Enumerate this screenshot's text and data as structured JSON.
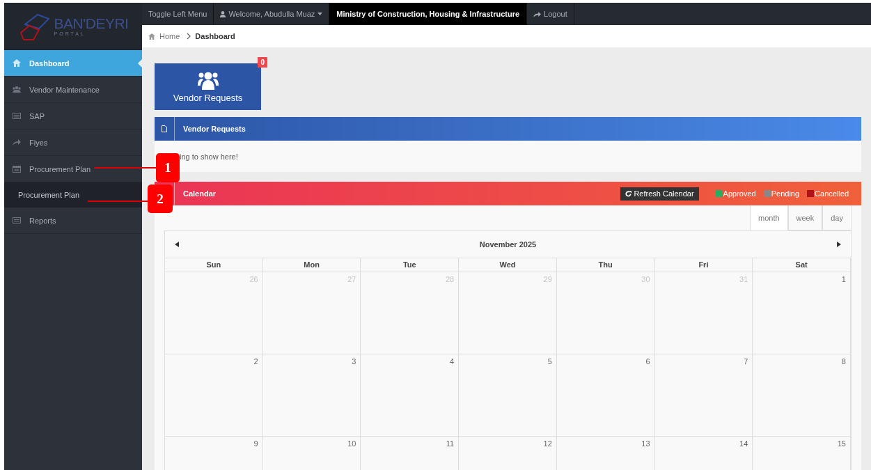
{
  "logo": {
    "name": "BAN'DEYRI",
    "tagline": "PORTAL"
  },
  "topbar": {
    "items": [
      {
        "label": "Toggle Left Menu",
        "kind": "plain"
      },
      {
        "label": "Welcome, Abudulla Muaz",
        "kind": "user"
      },
      {
        "label": "Ministry of Construction, Housing & Infrastructure",
        "kind": "title"
      },
      {
        "label": "Logout",
        "kind": "logout"
      }
    ]
  },
  "breadcrumb": [
    {
      "label": "Home",
      "selected": false
    },
    {
      "label": "Dashboard",
      "selected": true
    }
  ],
  "sidebar": {
    "items": [
      {
        "label": "Dashboard",
        "selected": true
      },
      {
        "label": "Vendor Maintenance",
        "selected": false
      },
      {
        "label": "SAP",
        "selected": false
      },
      {
        "label": "Fiyes",
        "selected": false
      },
      {
        "label": "Procurement Plan",
        "selected": false,
        "expanded": true,
        "children": [
          {
            "label": "Procurement Plan",
            "selected": false
          }
        ]
      },
      {
        "label": "Reports",
        "selected": false
      }
    ]
  },
  "tile": {
    "label": "Vendor Requests",
    "count": "0"
  },
  "vendor_panel": {
    "title": "Vendor Requests",
    "message": "ing to show here!"
  },
  "calendar": {
    "title": "Calendar",
    "refresh": "Refresh Calendar",
    "legend": [
      {
        "label": "Approved",
        "color": "#27ae60"
      },
      {
        "label": "Pending",
        "color": "#888888"
      },
      {
        "label": "Cancelled",
        "color": "#b0121b"
      }
    ],
    "views": [
      {
        "label": "month",
        "selected": true
      },
      {
        "label": "week",
        "selected": false
      },
      {
        "label": "day",
        "selected": false
      }
    ],
    "month": "November 2025",
    "weekdays": [
      "Sun",
      "Mon",
      "Tue",
      "Wed",
      "Thu",
      "Fri",
      "Sat"
    ],
    "weeks": [
      [
        {
          "day": "26",
          "muted": true
        },
        {
          "day": "27",
          "muted": true
        },
        {
          "day": "28",
          "muted": true
        },
        {
          "day": "29",
          "muted": true
        },
        {
          "day": "30",
          "muted": true
        },
        {
          "day": "31",
          "muted": true
        },
        {
          "day": "1",
          "muted": false
        }
      ],
      [
        {
          "day": "2",
          "muted": false
        },
        {
          "day": "3",
          "muted": false
        },
        {
          "day": "4",
          "muted": false
        },
        {
          "day": "5",
          "muted": false
        },
        {
          "day": "6",
          "muted": false
        },
        {
          "day": "7",
          "muted": false
        },
        {
          "day": "8",
          "muted": false
        }
      ],
      [
        {
          "day": "9",
          "muted": false
        },
        {
          "day": "10",
          "muted": false
        },
        {
          "day": "11",
          "muted": false
        },
        {
          "day": "12",
          "muted": false
        },
        {
          "day": "13",
          "muted": false
        },
        {
          "day": "14",
          "muted": false
        },
        {
          "day": "15",
          "muted": false
        }
      ]
    ]
  },
  "annotations": [
    {
      "label": "1"
    },
    {
      "label": "2"
    }
  ]
}
